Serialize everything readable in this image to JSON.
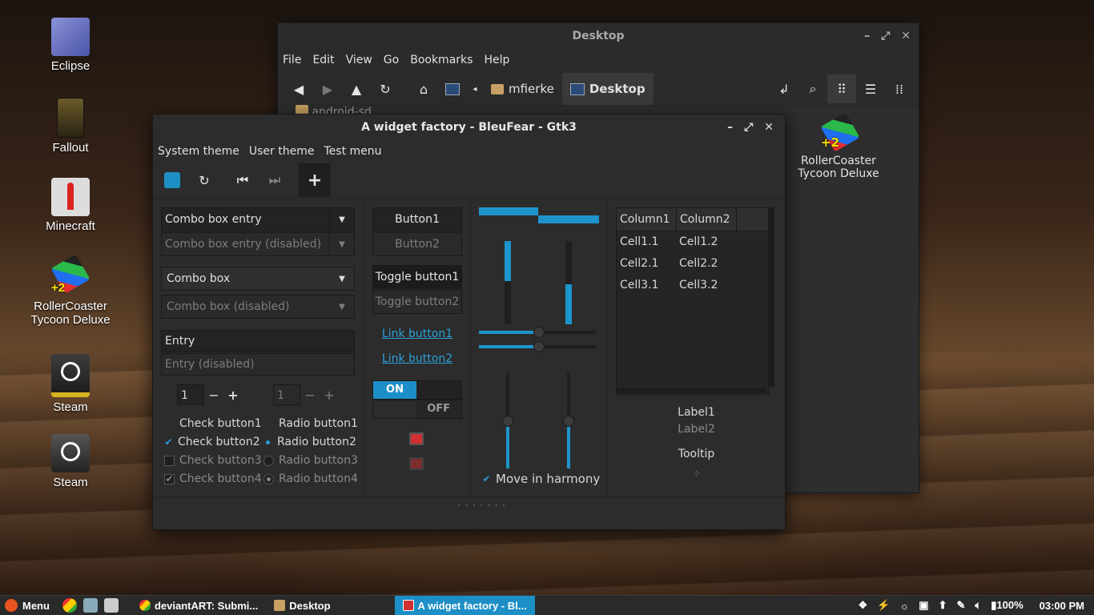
{
  "desktop": {
    "icons": [
      {
        "label": "Eclipse"
      },
      {
        "label": "Fallout"
      },
      {
        "label": "Minecraft"
      },
      {
        "label": "RollerCoaster Tycoon Deluxe"
      },
      {
        "label": "Steam"
      },
      {
        "label": "Steam"
      }
    ]
  },
  "file_manager": {
    "title": "Desktop",
    "menu": [
      "File",
      "Edit",
      "View",
      "Go",
      "Bookmarks",
      "Help"
    ],
    "breadcrumbs": [
      "mfierke",
      "Desktop"
    ],
    "partial_item": "android-sd",
    "file": {
      "label_line1": "RollerCoaster",
      "label_line2": "Tycoon Deluxe"
    }
  },
  "widget_factory": {
    "title": "A widget factory - BleuFear - Gtk3",
    "menu": [
      "System theme",
      "User theme",
      "Test menu"
    ],
    "col1": {
      "combo_entry": "Combo box entry",
      "combo_entry_disabled": "Combo box entry (disabled)",
      "combo": "Combo box",
      "combo_disabled": "Combo box (disabled)",
      "entry": "Entry",
      "entry_disabled": "Entry (disabled)",
      "spin1": "1",
      "spin2": "1",
      "checks": [
        "Check button1",
        "Check button2",
        "Check button3",
        "Check button4"
      ],
      "radios": [
        "Radio button1",
        "Radio button2",
        "Radio button3",
        "Radio button4"
      ]
    },
    "col2": {
      "button1": "Button1",
      "button2": "Button2",
      "toggle1": "Toggle button1",
      "toggle2": "Toggle button2",
      "link1": "Link button1",
      "link2": "Link button2",
      "switch_on": "ON",
      "switch_off": "OFF"
    },
    "col3": {
      "move_in_harmony": "Move in harmony"
    },
    "col4": {
      "columns": [
        "Column1",
        "Column2"
      ],
      "rows": [
        [
          "Cell1.1",
          "Cell1.2"
        ],
        [
          "Cell2.1",
          "Cell2.2"
        ],
        [
          "Cell3.1",
          "Cell3.2"
        ]
      ],
      "label1": "Label1",
      "label2": "Label2",
      "tooltip": "Tooltip"
    }
  },
  "taskbar": {
    "menu_label": "Menu",
    "tasks": [
      "deviantART: Submi...",
      "Desktop",
      "A widget factory - Bl..."
    ],
    "battery": "100%",
    "clock": "03:00 PM"
  },
  "colors": {
    "accent": "#1d95cc"
  }
}
